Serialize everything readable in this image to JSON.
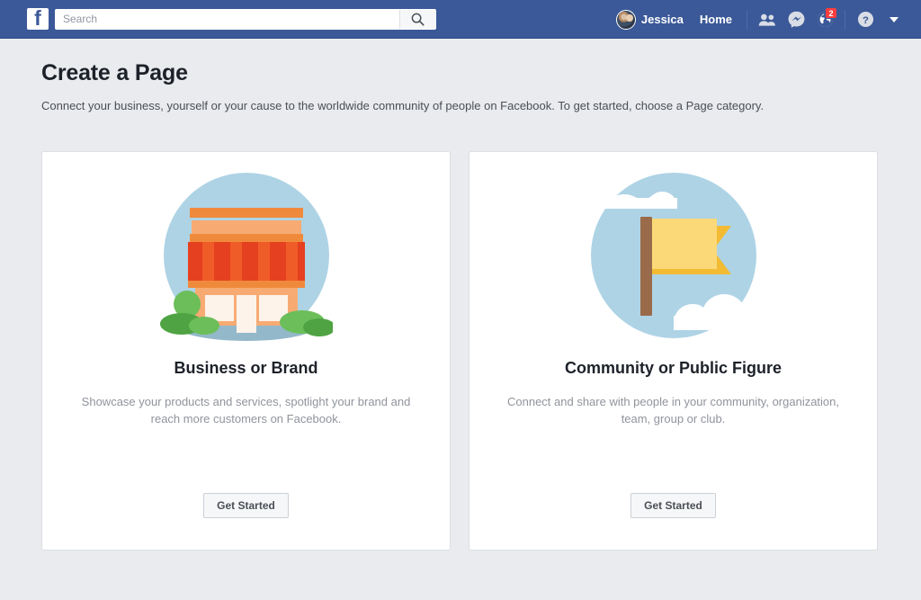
{
  "navbar": {
    "logo_letter": "f",
    "logo_icon": "facebook-logo",
    "search": {
      "placeholder": "Search",
      "value": "",
      "icon": "search-icon"
    },
    "user_name": "Jessica",
    "home_label": "Home",
    "icons": [
      {
        "name": "friend-requests-icon",
        "badge": ""
      },
      {
        "name": "messenger-icon",
        "badge": ""
      },
      {
        "name": "notifications-globe-icon",
        "badge": "2"
      },
      {
        "name": "help-icon",
        "badge": ""
      },
      {
        "name": "account-caret-icon",
        "badge": ""
      }
    ]
  },
  "main": {
    "title": "Create a Page",
    "subtitle": "Connect your business, yourself or your cause to the worldwide community of people on Facebook. To get started, choose a Page category.",
    "cards": [
      {
        "illustration": "storefront-illustration",
        "title": "Business or Brand",
        "description": "Showcase your products and services, spotlight your brand and reach more customers on Facebook.",
        "button_label": "Get Started"
      },
      {
        "illustration": "flag-illustration",
        "title": "Community or Public Figure",
        "description": "Connect and share with people in your community, organization, team, group or club.",
        "button_label": "Get Started"
      }
    ]
  },
  "colors": {
    "brand_blue": "#3b5998",
    "page_background": "#e9ebee",
    "card_background": "#ffffff",
    "badge_red": "#fa3e3e",
    "illustration_circle": "#aed3e5",
    "store_orange": "#f4a269",
    "store_awning_red": "#e03e22",
    "flag_yellow": "#f7cf5d",
    "flag_pole_brown": "#9a6b4a"
  }
}
